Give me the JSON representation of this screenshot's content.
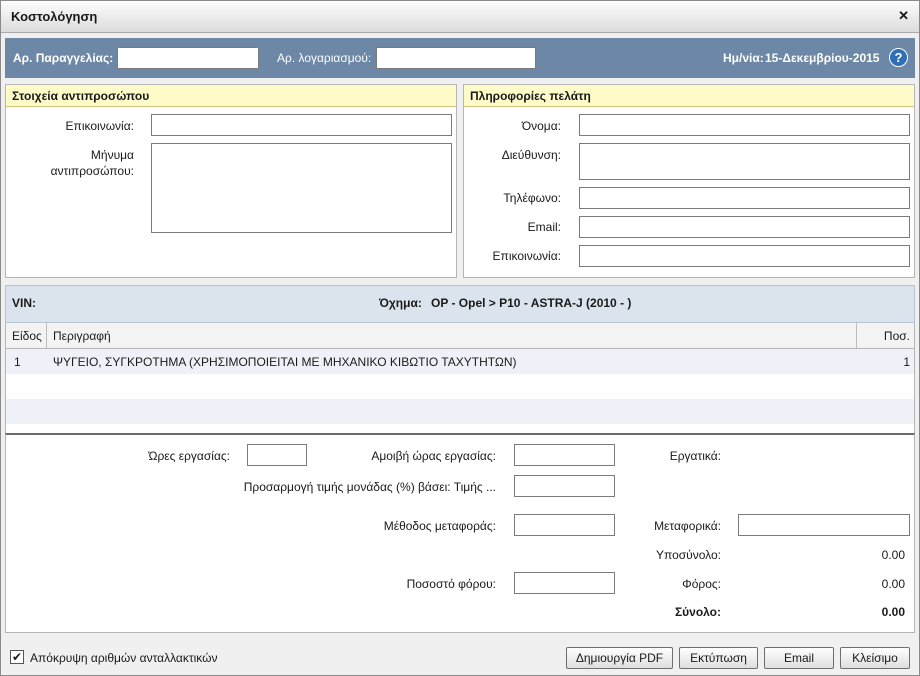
{
  "window": {
    "title": "Κοστολόγηση",
    "close_glyph": "✕"
  },
  "header": {
    "order_no_label": "Αρ. Παραγγελίας:",
    "order_no_value": "",
    "account_label": "Αρ. λογαριασμού:",
    "account_value": "",
    "date_label": "Ημ/νία:",
    "date_value": "15-Δεκεμβρίου-2015",
    "help_glyph": "?"
  },
  "dealer": {
    "title": "Στοιχεία αντιπροσώπου",
    "contact_label": "Επικοινωνία:",
    "message_label_1": "Μήνυμα",
    "message_label_2": "αντιπροσώπου:"
  },
  "customer": {
    "title": "Πληροφορίες πελάτη",
    "name_label": "Όνομα:",
    "address_label": "Διεύθυνση:",
    "phone_label": "Τηλέφωνο:",
    "email_label": "Email:",
    "contact_label": "Επικοινωνία:"
  },
  "vehicle": {
    "vin_label": "VIN:",
    "vehicle_label": "Όχημα:",
    "vehicle_value": "OP - Opel > P10 - ASTRA-J (2010 - )"
  },
  "table": {
    "headers": {
      "type": "Είδος",
      "description": "Περιγραφή",
      "qty": "Ποσ."
    },
    "rows": [
      {
        "type": "1",
        "description": "ΨΥΓΕΙΟ, ΣΥΓΚΡΟΤΗΜΑ  (ΧΡΗΣΙΜΟΠΟΙΕΙΤΑΙ ΜΕ ΜΗΧΑΝΙΚΟ ΚΙΒΩΤΙΟ ΤΑΧΥΤΗΤΩΝ)",
        "qty": "1"
      }
    ]
  },
  "costs": {
    "labor_hours_label": "Ώρες εργασίας:",
    "hourly_rate_label": "Αμοιβή ώρας εργασίας:",
    "labor_cost_label": "Εργατικά:",
    "unit_price_adjust_label": "Προσαρμογή τιμής μονάδας (%) βάσει: Τιμής ...",
    "shipping_method_label": "Μέθοδος μεταφοράς:",
    "shipping_cost_label": "Μεταφορικά:",
    "subtotal_label": "Υποσύνολο:",
    "subtotal_value": "0.00",
    "tax_rate_label": "Ποσοστό φόρου:",
    "tax_label": "Φόρος:",
    "tax_value": "0.00",
    "total_label": "Σύνολο:",
    "total_value": "0.00"
  },
  "footer": {
    "hide_part_numbers_label": "Απόκρυψη αριθμών ανταλλακτικών",
    "hide_part_numbers_checked": true,
    "check_glyph": "✔",
    "buttons": {
      "pdf": "Δημιουργία PDF",
      "print": "Εκτύπωση",
      "email": "Email",
      "close": "Κλείσιμο"
    }
  }
}
